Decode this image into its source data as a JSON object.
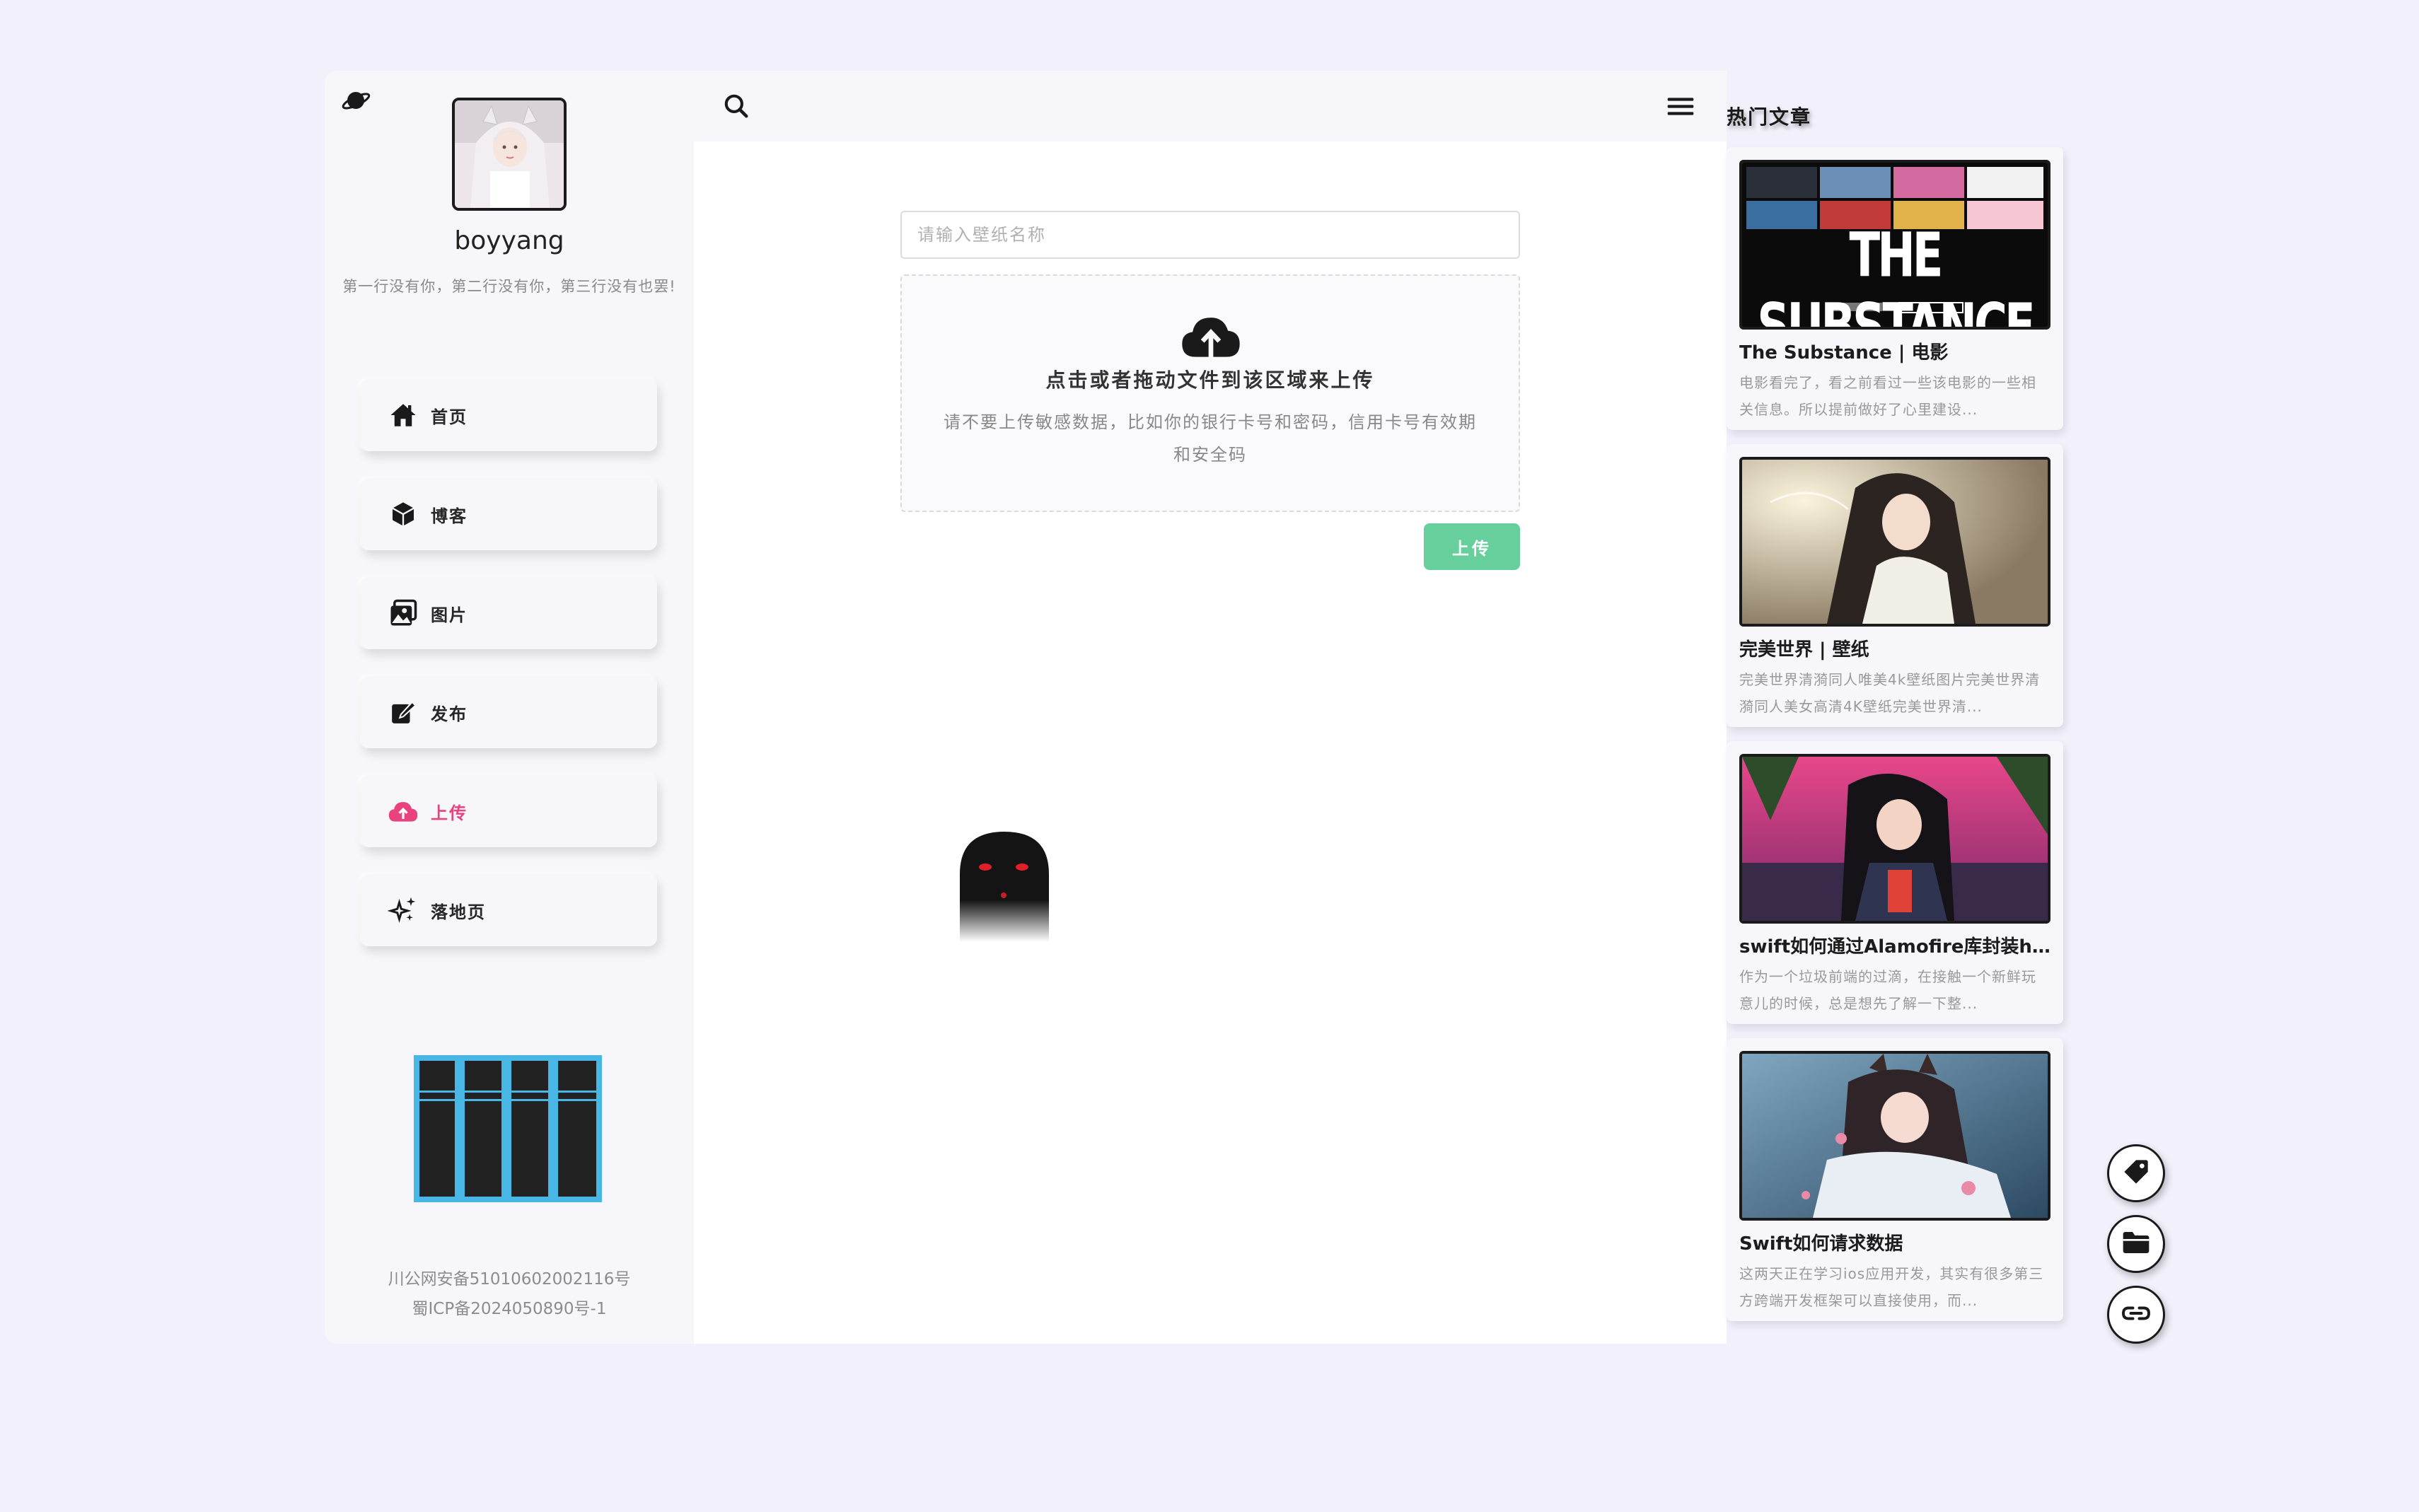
{
  "sidebar": {
    "username": "boyyang",
    "bio": "第一行没有你，第二行没有你，第三行没有也罢!",
    "nav": [
      {
        "label": "首页",
        "icon": "home-icon"
      },
      {
        "label": "博客",
        "icon": "cube-icon"
      },
      {
        "label": "图片",
        "icon": "images-icon"
      },
      {
        "label": "发布",
        "icon": "edit-icon"
      },
      {
        "label": "上传",
        "icon": "cloud-upload-icon",
        "active": true
      },
      {
        "label": "落地页",
        "icon": "sparkles-icon"
      }
    ],
    "footer": {
      "line1": "川公网安备51010602002116号",
      "line2": "蜀ICP备2024050890号-1"
    }
  },
  "upload": {
    "name_placeholder": "请输入壁纸名称",
    "name_value": "",
    "dropzone_title": "点击或者拖动文件到该区域来上传",
    "dropzone_hint": "请不要上传敏感数据，比如你的银行卡号和密码，信用卡号有效期和安全码",
    "button_label": "上传"
  },
  "hot": {
    "title": "热门文章",
    "articles": [
      {
        "title": "The Substance | 电影",
        "desc": "电影看完了，看之前看过一些该电影的一些相关信息。所以提前做好了心里建设...",
        "thumb_text": "THE SUBSTANCE"
      },
      {
        "title": "完美世界 | 壁纸",
        "desc": "完美世界清漪同人唯美4k壁纸图片完美世界清漪同人美女高清4K壁纸完美世界清..."
      },
      {
        "title": "swift如何通过Alamofire库封装ht...",
        "desc": "作为一个垃圾前端的过滴，在接触一个新鲜玩意儿的时候，总是想先了解一下整..."
      },
      {
        "title": "Swift如何请求数据",
        "desc": "这两天正在学习ios应用开发，其实有很多第三方跨端开发框架可以直接使用，而..."
      }
    ]
  },
  "colors": {
    "accent_pink": "#e8437e",
    "upload_green": "#67cf9c",
    "page_bg": "#f1f0fb"
  },
  "fabs": [
    "tag-icon",
    "folder-icon",
    "link-icon"
  ]
}
